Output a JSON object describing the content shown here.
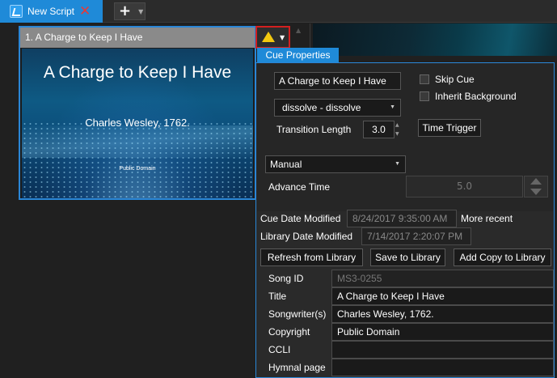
{
  "tabs": {
    "script_tab_label": "New Script"
  },
  "cue": {
    "header_title": "1. A Charge to Keep I Have",
    "slide_title": "A Charge to Keep I Have",
    "slide_author": "Charles Wesley, 1762.",
    "slide_copyright": "Public Domain"
  },
  "properties": {
    "tab_label": "Cue Properties",
    "cue_name": "A Charge to Keep I Have",
    "skip_cue_label": "Skip Cue",
    "inherit_bg_label": "Inherit Background",
    "transition_select": "dissolve - dissolve",
    "transition_length_label": "Transition Length",
    "transition_length_value": "3.0",
    "time_trigger_label": "Time Trigger",
    "advance_mode": "Manual",
    "advance_time_label": "Advance Time",
    "advance_time_value": "5.0",
    "cue_date_label": "Cue Date Modified",
    "cue_date_value": "8/24/2017 9:35:00 AM",
    "more_recent_label": "More recent",
    "library_date_label": "Library Date Modified",
    "library_date_value": "7/14/2017 2:20:07 PM",
    "refresh_label": "Refresh from Library",
    "save_label": "Save to Library",
    "add_copy_label": "Add Copy to Library"
  },
  "metadata": [
    {
      "label": "Song ID",
      "value": "MS3-0255"
    },
    {
      "label": "Title",
      "value": "A Charge to Keep I Have"
    },
    {
      "label": "Songwriter(s)",
      "value": "Charles Wesley, 1762."
    },
    {
      "label": "Copyright",
      "value": "Public Domain"
    },
    {
      "label": "CCLI",
      "value": ""
    },
    {
      "label": "Hymnal page",
      "value": ""
    }
  ],
  "colors": {
    "accent": "#1f8ad8",
    "warning": "#f2c80f",
    "warning_border": "#d42020",
    "close": "#e53a3a"
  },
  "icons": [
    "app-script-icon",
    "close-icon",
    "plus-icon",
    "chevron-down-icon",
    "warning-icon"
  ]
}
